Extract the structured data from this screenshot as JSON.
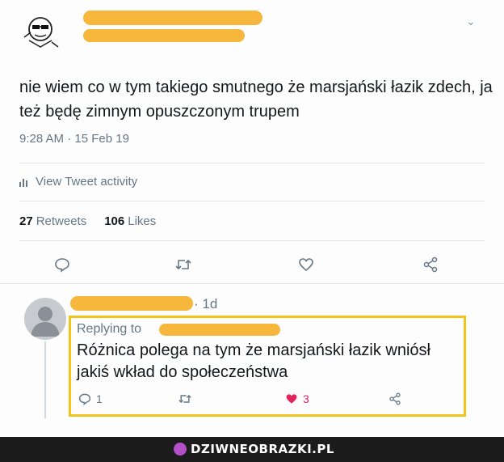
{
  "tweet": {
    "text": "nie wiem co w tym takiego smutnego że marsjański łazik zdech, ja też będę zimnym opuszczonym trupem",
    "timestamp": "9:28 AM · 15 Feb 19",
    "activity_label": "View Tweet activity",
    "retweets_count": "27",
    "retweets_label": "Retweets",
    "likes_count": "106",
    "likes_label": "Likes",
    "actions": [
      {
        "icon": "reply-icon"
      },
      {
        "icon": "retweet-icon"
      },
      {
        "icon": "like-icon"
      },
      {
        "icon": "share-icon"
      }
    ]
  },
  "reply": {
    "time": "· 1d",
    "replying_to": "Replying to",
    "text": "Różnica polega na tym że marsjański łazik wniósł jakiś wkład do społeczeństwa",
    "reply_count": "1",
    "like_count": "3"
  },
  "colors": {
    "redaction": "#f6b73c",
    "highlight_border": "#f0c419",
    "like_active": "#e0245e",
    "muted": "#657786"
  },
  "footer": {
    "brand": "DZIWNEOBRAZKI.PL"
  }
}
